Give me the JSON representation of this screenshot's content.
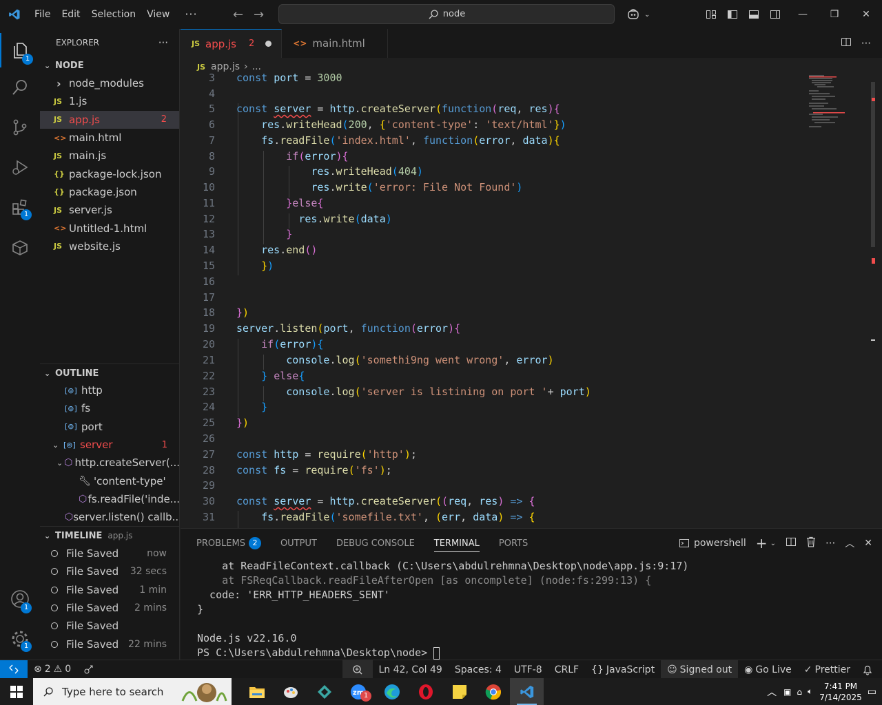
{
  "titlebar": {
    "menu": [
      "File",
      "Edit",
      "Selection",
      "View"
    ],
    "more": "···",
    "search": "node"
  },
  "activitybar": {
    "items": [
      {
        "name": "explorer",
        "badge": "1"
      },
      {
        "name": "search"
      },
      {
        "name": "source-control"
      },
      {
        "name": "run-debug"
      },
      {
        "name": "extensions",
        "badge": "1"
      },
      {
        "name": "remote-explorer"
      }
    ],
    "bottom": [
      {
        "name": "accounts",
        "badge": "1"
      },
      {
        "name": "manage",
        "badge": "1"
      }
    ]
  },
  "sidebar": {
    "title": "EXPLORER",
    "folder": "NODE",
    "files": [
      {
        "label": "node_modules",
        "kind": "folder"
      },
      {
        "label": "1.js",
        "kind": "js"
      },
      {
        "label": "app.js",
        "kind": "js",
        "count": "2",
        "selected": true
      },
      {
        "label": "main.html",
        "kind": "html"
      },
      {
        "label": "main.js",
        "kind": "js"
      },
      {
        "label": "package-lock.json",
        "kind": "json"
      },
      {
        "label": "package.json",
        "kind": "json"
      },
      {
        "label": "server.js",
        "kind": "js"
      },
      {
        "label": "Untitled-1.html",
        "kind": "html"
      },
      {
        "label": "website.js",
        "kind": "js"
      }
    ],
    "outline": {
      "title": "OUTLINE",
      "items": [
        {
          "label": "http"
        },
        {
          "label": "fs"
        },
        {
          "label": "port"
        },
        {
          "label": "server",
          "count": "1"
        },
        {
          "label": "http.createServer(..."
        },
        {
          "label": "'content-type'"
        },
        {
          "label": "fs.readFile('inde..."
        },
        {
          "label": "server.listen() callb..."
        }
      ]
    },
    "timeline": {
      "title": "TIMELINE",
      "file": "app.js",
      "items": [
        {
          "label": "File Saved",
          "when": "now"
        },
        {
          "label": "File Saved",
          "when": "32 secs"
        },
        {
          "label": "File Saved",
          "when": "1 min"
        },
        {
          "label": "File Saved",
          "when": "2 mins"
        },
        {
          "label": "File Saved",
          "when": ""
        },
        {
          "label": "File Saved",
          "when": "22 mins"
        }
      ]
    }
  },
  "tabs": [
    {
      "label": "app.js",
      "icon": "JS",
      "count": "2",
      "dirty": true,
      "active": true
    },
    {
      "label": "main.html",
      "icon": "<>"
    }
  ],
  "breadcrumb": {
    "file": "app.js",
    "rest": "..."
  },
  "code": {
    "lines": [
      {
        "n": "3"
      },
      {
        "n": "4"
      },
      {
        "n": "5"
      },
      {
        "n": "6"
      },
      {
        "n": "7"
      },
      {
        "n": "8"
      },
      {
        "n": "9"
      },
      {
        "n": "10"
      },
      {
        "n": "11"
      },
      {
        "n": "12"
      },
      {
        "n": "13"
      },
      {
        "n": "14"
      },
      {
        "n": "15"
      },
      {
        "n": "16"
      },
      {
        "n": "17"
      },
      {
        "n": "18"
      },
      {
        "n": "19"
      },
      {
        "n": "20"
      },
      {
        "n": "21"
      },
      {
        "n": "22"
      },
      {
        "n": "23"
      },
      {
        "n": "24"
      },
      {
        "n": "25"
      },
      {
        "n": "26"
      },
      {
        "n": "27"
      },
      {
        "n": "28"
      },
      {
        "n": "29"
      },
      {
        "n": "30"
      },
      {
        "n": "31"
      }
    ]
  },
  "panel": {
    "tabs": [
      "PROBLEMS",
      "OUTPUT",
      "DEBUG CONSOLE",
      "TERMINAL",
      "PORTS"
    ],
    "problems_count": "2",
    "shell": "powershell",
    "terminal_lines": [
      "    at ReadFileContext.callback (C:\\Users\\abdulrehmna\\Desktop\\node\\app.js:9:17)",
      "    at FSReqCallback.readFileAfterOpen [as oncomplete] (node:fs:299:13) {",
      "  code: 'ERR_HTTP_HEADERS_SENT'",
      "}",
      "",
      "Node.js v22.16.0",
      "PS C:\\Users\\abdulrehmna\\Desktop\\node> "
    ]
  },
  "statusbar": {
    "errors": "2",
    "warnings": "0",
    "position": "Ln 42, Col 49",
    "spaces": "Spaces: 4",
    "encoding": "UTF-8",
    "eol": "CRLF",
    "language": "JavaScript",
    "account": "Signed out",
    "golive": "Go Live",
    "prettier": "Prettier"
  },
  "taskbar": {
    "search_placeholder": "Type here to search",
    "time": "7:41 PM",
    "date": "7/14/2025",
    "zoom_badge": "1"
  },
  "colors": {
    "accent": "#0078d4",
    "error": "#f14c4c",
    "editor_bg": "#1f1f1f"
  }
}
